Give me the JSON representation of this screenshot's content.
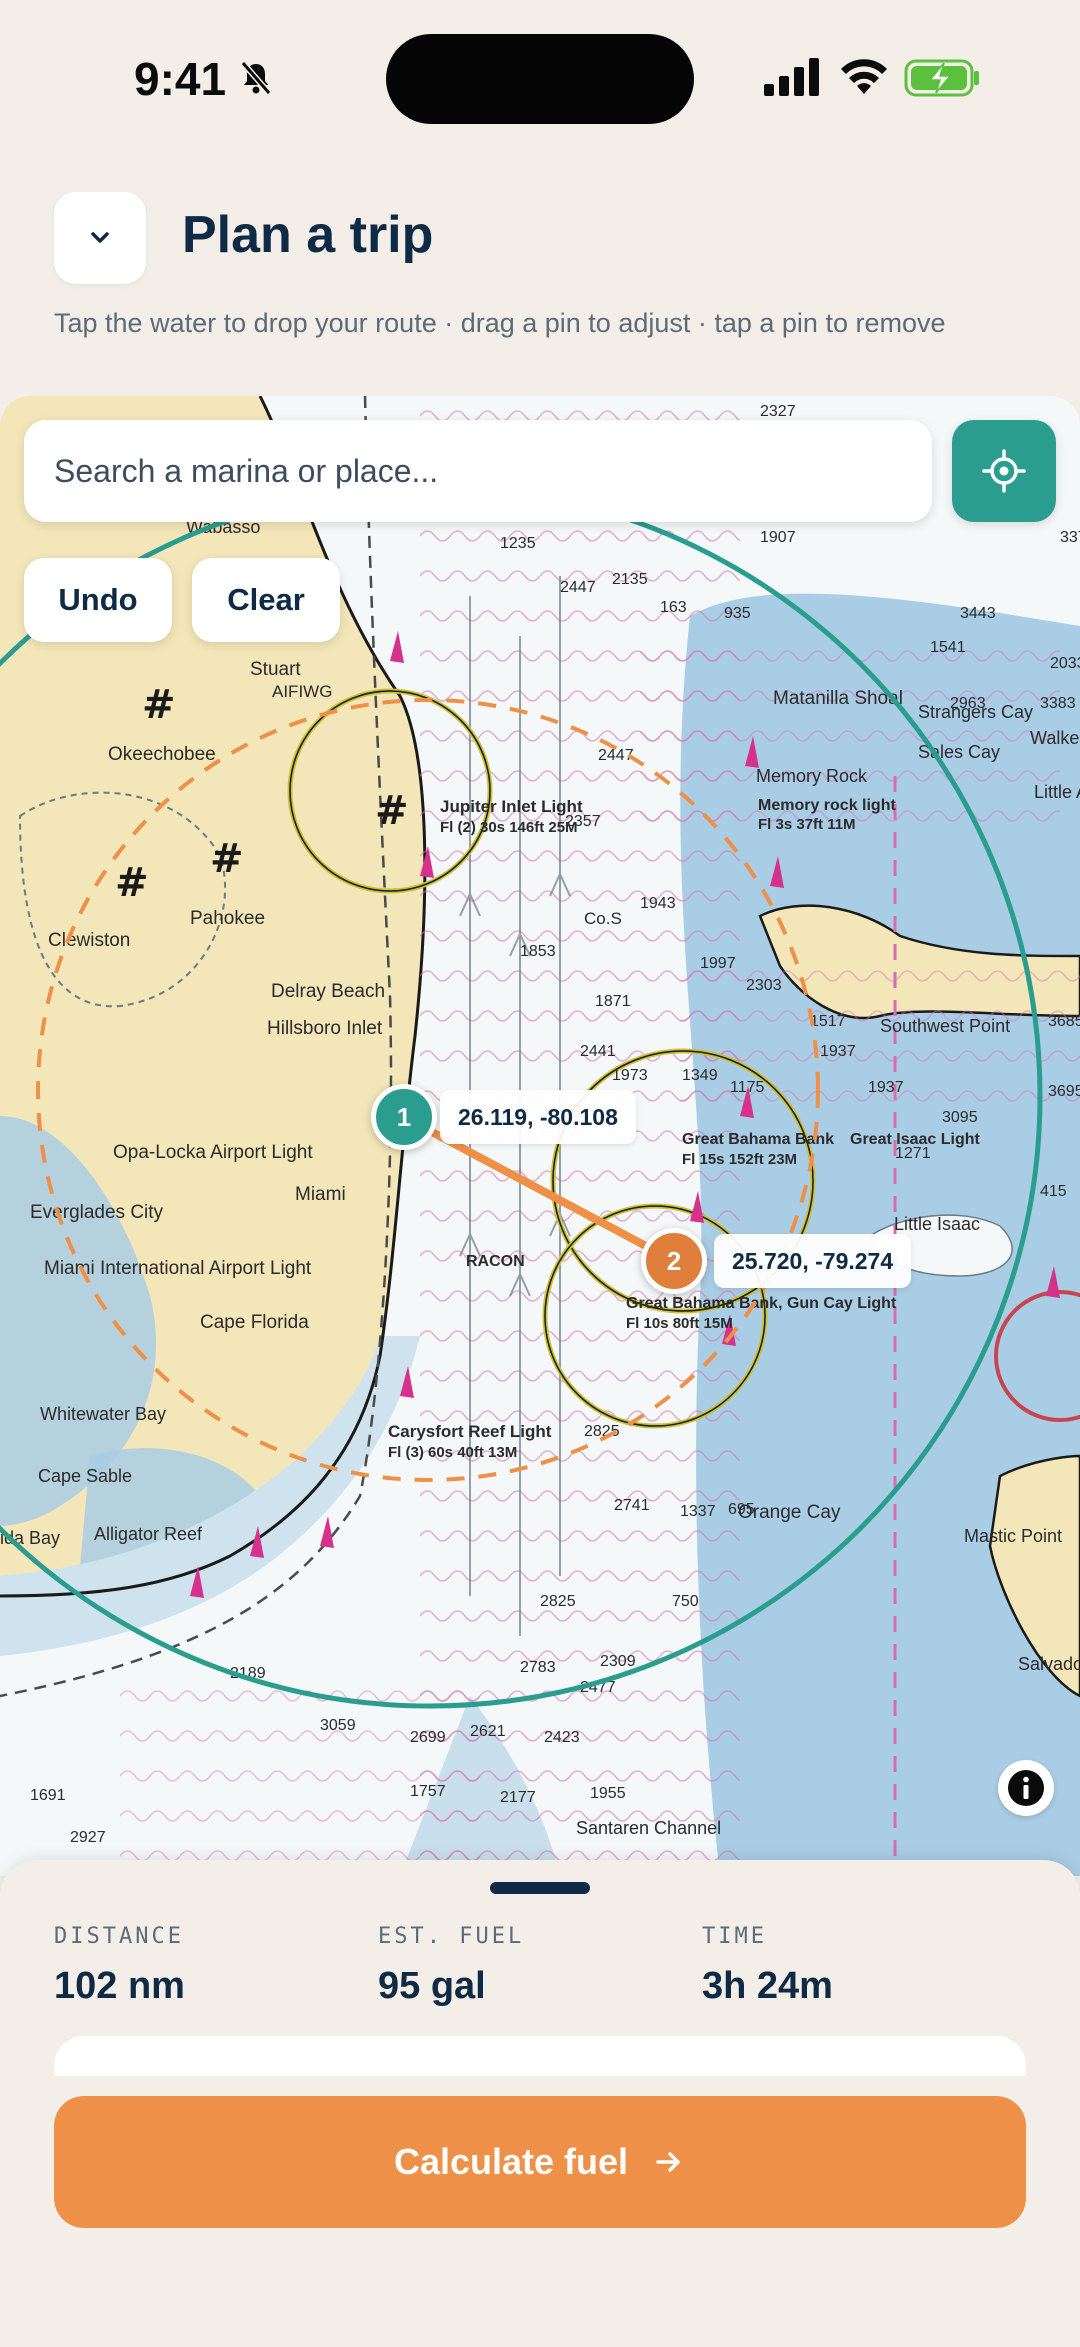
{
  "status_bar": {
    "time": "9:41",
    "icons": [
      "bell-slash-icon",
      "cellular-signal-icon",
      "wifi-icon",
      "battery-charging-icon"
    ]
  },
  "header": {
    "title": "Plan a trip",
    "subtitle": "Tap the water to drop your route · drag a pin to adjust · tap a pin to remove",
    "collapse_icon": "chevron-down-icon"
  },
  "map": {
    "search_placeholder": "Search a marina or place...",
    "undo_label": "Undo",
    "clear_label": "Clear",
    "locate_icon": "crosshair-icon",
    "info_icon": "info-icon",
    "waypoints": [
      {
        "number": "1",
        "coords": "26.119, -80.108",
        "color": "#2a9d8f"
      },
      {
        "number": "2",
        "coords": "25.720, -79.274",
        "color": "#e07f3c"
      }
    ],
    "places": {
      "okeechobee": "Okeechobee",
      "stuart": "Stuart",
      "aifiwg": "AIFIWG",
      "wabasso": "Wabasso",
      "pahokee": "Pahokee",
      "clewiston": "Clewiston",
      "delray": "Delray Beach",
      "hillsboro": "Hillsboro Inlet",
      "jupiter": "Jupiter Inlet Light",
      "jupiter_detail": "Fl (2) 30s 146ft 25M",
      "opa_locka": "Opa-Locka Airport Light",
      "miami": "Miami",
      "everglades": "Everglades City",
      "miami_intl": "Miami International Airport Light",
      "cape_florida": "Cape Florida",
      "whitewater": "Whitewater Bay",
      "cape_sable": "Cape Sable",
      "alligator": "Alligator Reef",
      "florida_bay": "ida Bay",
      "carysfort": "Carysfort Reef Light",
      "carysfort_detail": "Fl (3) 60s 40ft 13M",
      "matanilla": "Matanilla Shoal",
      "memory_rock": "Memory Rock",
      "memory_light": "Memory rock light",
      "memory_detail": "Fl 3s 37ft 11M",
      "strangers": "Strangers Cay",
      "sales": "Sales Cay",
      "walkers": "Walkers",
      "little_ab": "Little Ab",
      "southwest": "Southwest Point",
      "great_bahama": "Great Bahama Bank",
      "great_isaac": "Great Isaac Light",
      "great_isaac_detail": "Fl 15s 152ft 23M",
      "little_isaac": "Little Isaac",
      "gun_cay": "Great Bahama Bank, Gun Cay Light",
      "gun_cay_detail": "Fl 10s 80ft 15M",
      "orange_cay": "Orange Cay",
      "mastic": "Mastic Point",
      "salvador": "Salvado",
      "santaren": "Santaren Channel",
      "racon": "RACON",
      "cos": "Co.S"
    }
  },
  "trip_summary": {
    "distance_label": "DISTANCE",
    "distance_value": "102 nm",
    "fuel_label": "EST. FUEL",
    "fuel_value": "95 gal",
    "time_label": "TIME",
    "time_value": "3h 24m"
  },
  "cta": {
    "label": "Calculate fuel",
    "icon": "arrow-right-icon"
  },
  "colors": {
    "accent_teal": "#2a9d8f",
    "accent_orange": "#ef9048",
    "navy": "#0f2a45",
    "land": "#f3e6b8",
    "deep_water": "#a9cde4",
    "shallow_water": "#f4f8f8"
  }
}
